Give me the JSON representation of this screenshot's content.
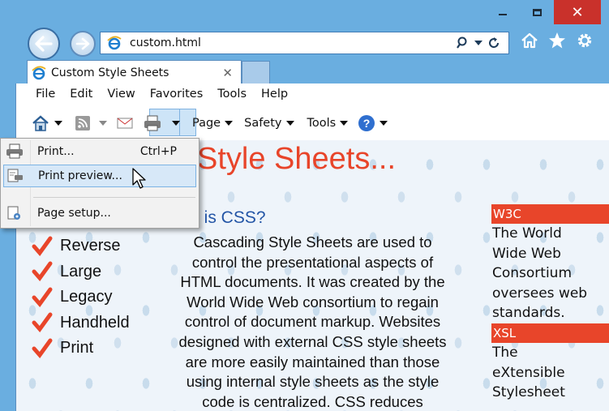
{
  "window": {
    "url": "custom.html",
    "tab_title": "Custom Style Sheets",
    "tab_close": "✕"
  },
  "menubar": [
    "File",
    "Edit",
    "View",
    "Favorites",
    "Tools",
    "Help"
  ],
  "commandbar": {
    "page": "Page",
    "safety": "Safety",
    "tools": "Tools"
  },
  "print_menu": {
    "items": [
      {
        "label": "Print...",
        "shortcut": "Ctrl+P",
        "icon": "printer-icon"
      },
      {
        "label": "Print preview...",
        "shortcut": "",
        "icon": "print-preview-icon",
        "highlighted": true
      },
      {
        "label": "Page setup...",
        "shortcut": "",
        "icon": "page-setup-icon"
      }
    ]
  },
  "page": {
    "heading": "Style Sheets...",
    "subheading": "t is CSS?",
    "checklist": [
      "Reverse",
      "Large",
      "Legacy",
      "Handheld",
      "Print"
    ],
    "body_lines": [
      "Cascading Style Sheets are used to",
      "control the presentational aspects of",
      "HTML documents. It was created by the",
      "World Wide Web consortium to regain",
      "control of document markup. Websites",
      "designed with external CSS style sheets",
      "are more easily maintained than those",
      "using internal style sheets as the style",
      "code is centralized. CSS reduces"
    ],
    "sidebar": {
      "w3c_head": "W3C",
      "w3c_text": "The World\nWide Web\nConsortium\noversees web\nstandards.",
      "xsl_head": "XSL",
      "xsl_text": "The\neXtensible\nStylesheet"
    }
  },
  "colors": {
    "accent_red": "#e8452a",
    "link_blue": "#2355a6",
    "frame_blue": "#6aaee0",
    "menu_highlight": "#d7e8f8"
  }
}
